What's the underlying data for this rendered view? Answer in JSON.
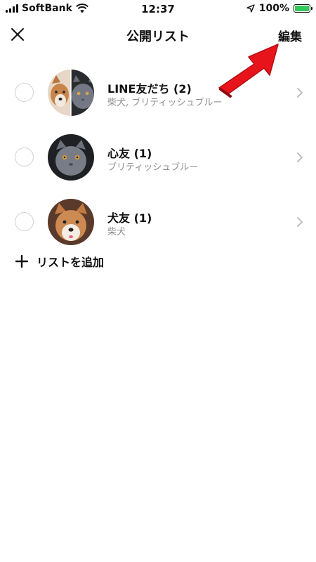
{
  "status": {
    "carrier": "SoftBank",
    "time": "12:37",
    "battery_text": "100%",
    "battery_level": 1.0
  },
  "header": {
    "title": "公開リスト",
    "edit_label": "編集",
    "close_icon": "close-icon"
  },
  "lists": [
    {
      "name": "LINE友だち (2)",
      "members": "柴犬, ブリティッシュブルー"
    },
    {
      "name": "心友 (1)",
      "members": "ブリティッシュブルー"
    },
    {
      "name": "犬友 (1)",
      "members": "柴犬"
    }
  ],
  "add_list": {
    "label": "リストを追加"
  },
  "colors": {
    "accent_arrow": "#e8141c",
    "radio_border": "#d1d1d1",
    "subtext": "#8e8e93",
    "battery_fill": "#34c759"
  }
}
